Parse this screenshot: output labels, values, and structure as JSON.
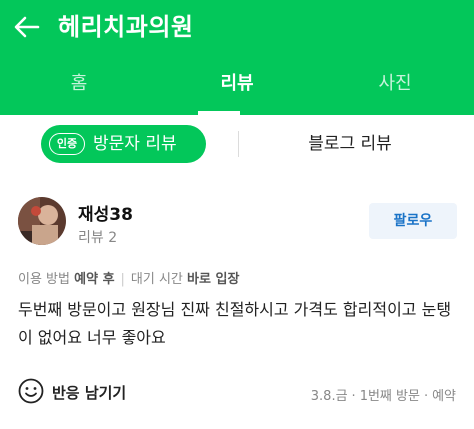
{
  "header": {
    "title": "헤리치과의원"
  },
  "tabs": [
    {
      "label": "홈"
    },
    {
      "label": "리뷰"
    },
    {
      "label": "사진"
    }
  ],
  "subtabs": {
    "badge": "인증",
    "visitor_review": "방문자 리뷰",
    "blog_review": "블로그 리뷰"
  },
  "review": {
    "username": "재성38",
    "review_count": "리뷰 2",
    "follow_label": "팔로우",
    "meta": {
      "method_label": "이용 방법",
      "method_value": "예약 후",
      "wait_label": "대기 시간",
      "wait_value": "바로 입장"
    },
    "text": "두번째 방문이고 원장님 진짜 친절하시고 가격도 합리적이고 눈탱이 없어요 너무 좋아요",
    "react_label": "반응 남기기",
    "visit_date": "3.8.금",
    "visit_count": "1번째 방문",
    "visit_type": "예약"
  },
  "colors": {
    "brand_green": "#03c75a",
    "follow_blue": "#1a73c7"
  }
}
